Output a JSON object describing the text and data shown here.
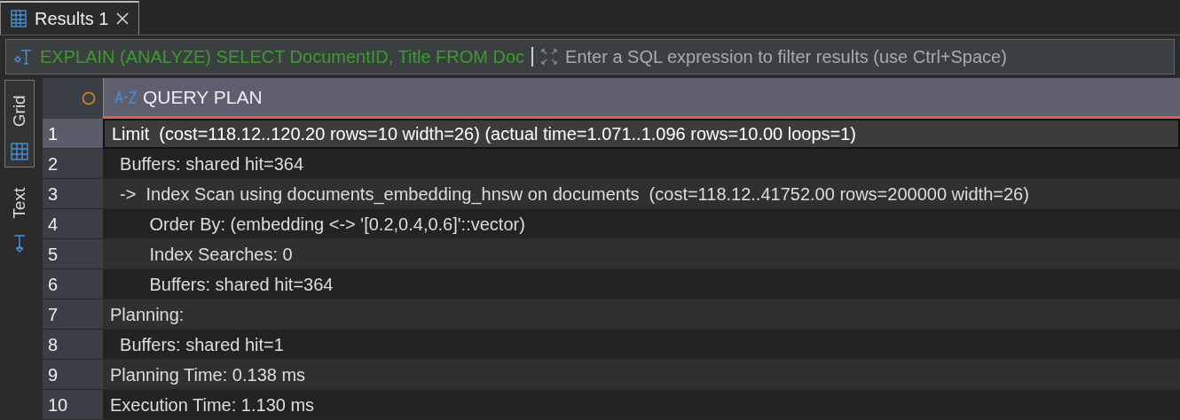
{
  "tabs": [
    {
      "label": "Results 1",
      "selected": true
    }
  ],
  "filter": {
    "query": "EXPLAIN (ANALYZE) SELECT DocumentID, Title FROM Doc",
    "placeholder": "Enter a SQL expression to filter results (use Ctrl+Space)"
  },
  "view_tabs": [
    {
      "label": "Grid",
      "kind": "grid",
      "selected": true
    },
    {
      "label": "Text",
      "kind": "text",
      "selected": false
    }
  ],
  "table": {
    "columns": [
      {
        "label": "QUERY PLAN"
      }
    ],
    "rows": [
      {
        "number": "1",
        "text": "Limit  (cost=118.12..120.20 rows=10 width=26) (actual time=1.071..1.096 rows=10.00 loops=1)",
        "selected": true
      },
      {
        "number": "2",
        "text": "  Buffers: shared hit=364",
        "selected": false
      },
      {
        "number": "3",
        "text": "  ->  Index Scan using documents_embedding_hnsw on documents  (cost=118.12..41752.00 rows=200000 width=26)",
        "selected": false
      },
      {
        "number": "4",
        "text": "        Order By: (embedding <-> '[0.2,0.4,0.6]'::vector)",
        "selected": false
      },
      {
        "number": "5",
        "text": "        Index Searches: 0",
        "selected": false
      },
      {
        "number": "6",
        "text": "        Buffers: shared hit=364",
        "selected": false
      },
      {
        "number": "7",
        "text": "Planning:",
        "selected": false
      },
      {
        "number": "8",
        "text": "  Buffers: shared hit=1",
        "selected": false
      },
      {
        "number": "9",
        "text": "Planning Time: 0.138 ms",
        "selected": false
      },
      {
        "number": "10",
        "text": "Execution Time: 1.130 ms",
        "selected": false
      }
    ]
  }
}
